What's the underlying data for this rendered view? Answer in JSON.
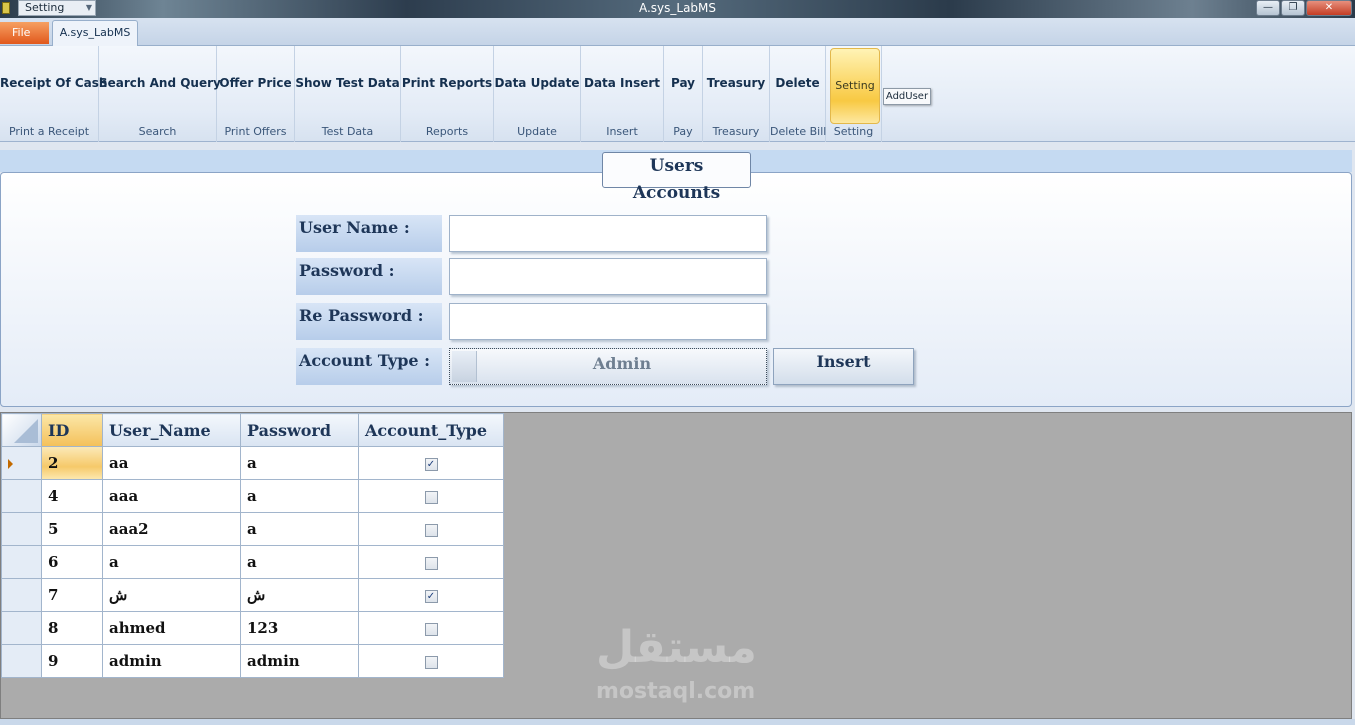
{
  "window": {
    "title": "A.sys_LabMS",
    "quick_access": "Setting",
    "min_glyph": "—",
    "max_glyph": "❐",
    "close_glyph": "✕"
  },
  "ribbon": {
    "file_tab": "File",
    "main_tab": "A.sys_LabMS",
    "groups": [
      {
        "button": "Receipt Of Cash",
        "caption": "Print a Receipt"
      },
      {
        "button": "Search And Query",
        "caption": "Search"
      },
      {
        "button": "Offer Price",
        "caption": "Print Offers"
      },
      {
        "button": "Show Test Data",
        "caption": "Test Data"
      },
      {
        "button": "Print Reports",
        "caption": "Reports"
      },
      {
        "button": "Data Update",
        "caption": "Update"
      },
      {
        "button": "Data Insert",
        "caption": "Insert"
      },
      {
        "button": "Pay",
        "caption": "Pay"
      },
      {
        "button": "Treasury",
        "caption": "Treasury"
      },
      {
        "button": "Delete",
        "caption": "Delete Bill"
      },
      {
        "button": "Setting",
        "caption": "Setting"
      }
    ],
    "tooltip": "AddUser"
  },
  "form": {
    "title": "Users Accounts",
    "user_name_label": "User Name :",
    "password_label": "Password :",
    "re_password_label": "Re Password :",
    "account_type_label": "Account Type :",
    "user_name_value": "",
    "password_value": "",
    "re_password_value": "",
    "account_type_value": "Admin",
    "insert_button": "Insert"
  },
  "grid": {
    "columns": [
      "ID",
      "User_Name",
      "Password",
      "Account_Type"
    ],
    "rows": [
      {
        "id": "2",
        "user": "aa",
        "pass": "a",
        "admin": true
      },
      {
        "id": "4",
        "user": "aaa",
        "pass": "a",
        "admin": false
      },
      {
        "id": "5",
        "user": "aaa2",
        "pass": "a",
        "admin": false
      },
      {
        "id": "6",
        "user": "a",
        "pass": "a",
        "admin": false
      },
      {
        "id": "7",
        "user": "ش",
        "pass": "ش",
        "admin": true
      },
      {
        "id": "8",
        "user": "ahmed",
        "pass": "123",
        "admin": false
      },
      {
        "id": "9",
        "user": "admin",
        "pass": "admin",
        "admin": false
      }
    ]
  },
  "watermark": {
    "arabic": "مستقل",
    "latin": "mostaql.com"
  },
  "colors": {
    "accent_orange": "#e1581c",
    "ribbon_active": "#fbd86a",
    "grid_background": "#ababab",
    "check_mark": "#1c3d7a"
  }
}
